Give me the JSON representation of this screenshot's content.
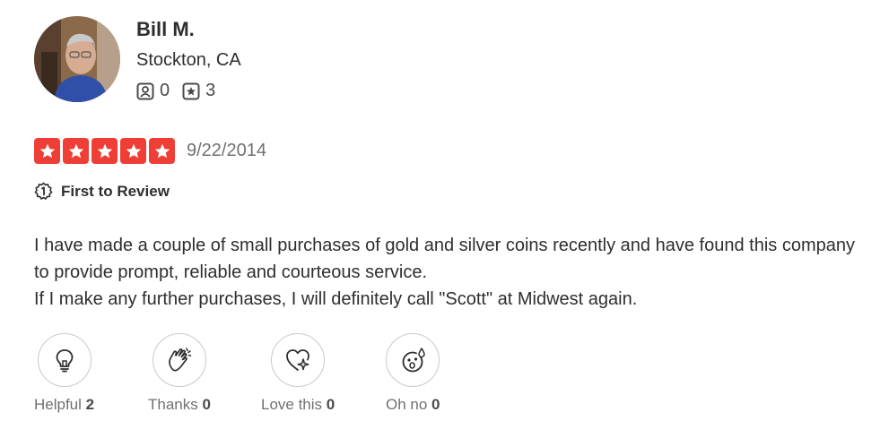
{
  "reviewer": {
    "name": "Bill M.",
    "location": "Stockton, CA",
    "friends_count": "0",
    "reviews_count": "3"
  },
  "review": {
    "rating": 5,
    "date": "9/22/2014",
    "badge": "First to Review",
    "paragraphs": [
      "I have made a couple of small purchases of gold and silver coins recently and have found this company to provide prompt, reliable and courteous service.",
      "If I make any further purchases, I will definitely call \"Scott\" at Midwest again."
    ]
  },
  "reactions": [
    {
      "label": "Helpful",
      "count": "2",
      "icon": "lightbulb-icon"
    },
    {
      "label": "Thanks",
      "count": "0",
      "icon": "clapping-hands-icon"
    },
    {
      "label": "Love this",
      "count": "0",
      "icon": "heart-sparkle-icon"
    },
    {
      "label": "Oh no",
      "count": "0",
      "icon": "shocked-face-icon"
    }
  ],
  "colors": {
    "star_red": "#ef3e36",
    "text": "#2d2e2f",
    "muted": "#6e7072"
  }
}
